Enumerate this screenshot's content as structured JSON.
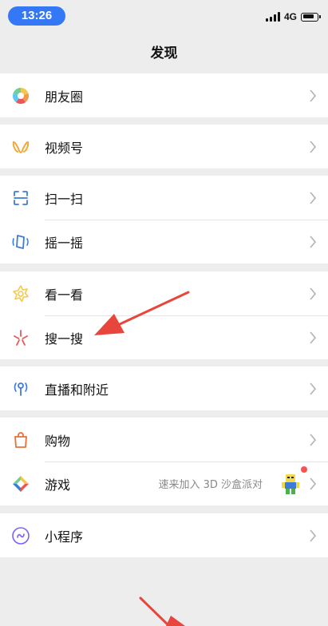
{
  "status_bar": {
    "time": "13:26",
    "network": "4G",
    "icons": [
      "signal-icon",
      "battery-icon"
    ]
  },
  "nav": {
    "title": "发现"
  },
  "groups": [
    {
      "items": [
        {
          "label": "朋友圈",
          "icon": "moments-icon"
        }
      ]
    },
    {
      "items": [
        {
          "label": "视频号",
          "icon": "channels-icon"
        }
      ]
    },
    {
      "items": [
        {
          "label": "扫一扫",
          "icon": "scan-icon"
        },
        {
          "label": "摇一摇",
          "icon": "shake-icon"
        }
      ]
    },
    {
      "items": [
        {
          "label": "看一看",
          "icon": "top-stories-icon"
        },
        {
          "label": "搜一搜",
          "icon": "search-icon"
        }
      ]
    },
    {
      "items": [
        {
          "label": "直播和附近",
          "icon": "live-nearby-icon"
        }
      ]
    },
    {
      "items": [
        {
          "label": "购物",
          "icon": "shopping-bag-icon"
        },
        {
          "label": "游戏",
          "icon": "games-icon",
          "subtitle": "速来加入 3D 沙盒派对",
          "badge": "red-dot"
        }
      ]
    },
    {
      "items": [
        {
          "label": "小程序",
          "icon": "mini-programs-icon"
        }
      ]
    }
  ],
  "colors": {
    "background": "#ededed",
    "cell": "#ffffff",
    "time_pill": "#3478f6",
    "arrow": "#e8453c",
    "badge": "#fa5151"
  }
}
